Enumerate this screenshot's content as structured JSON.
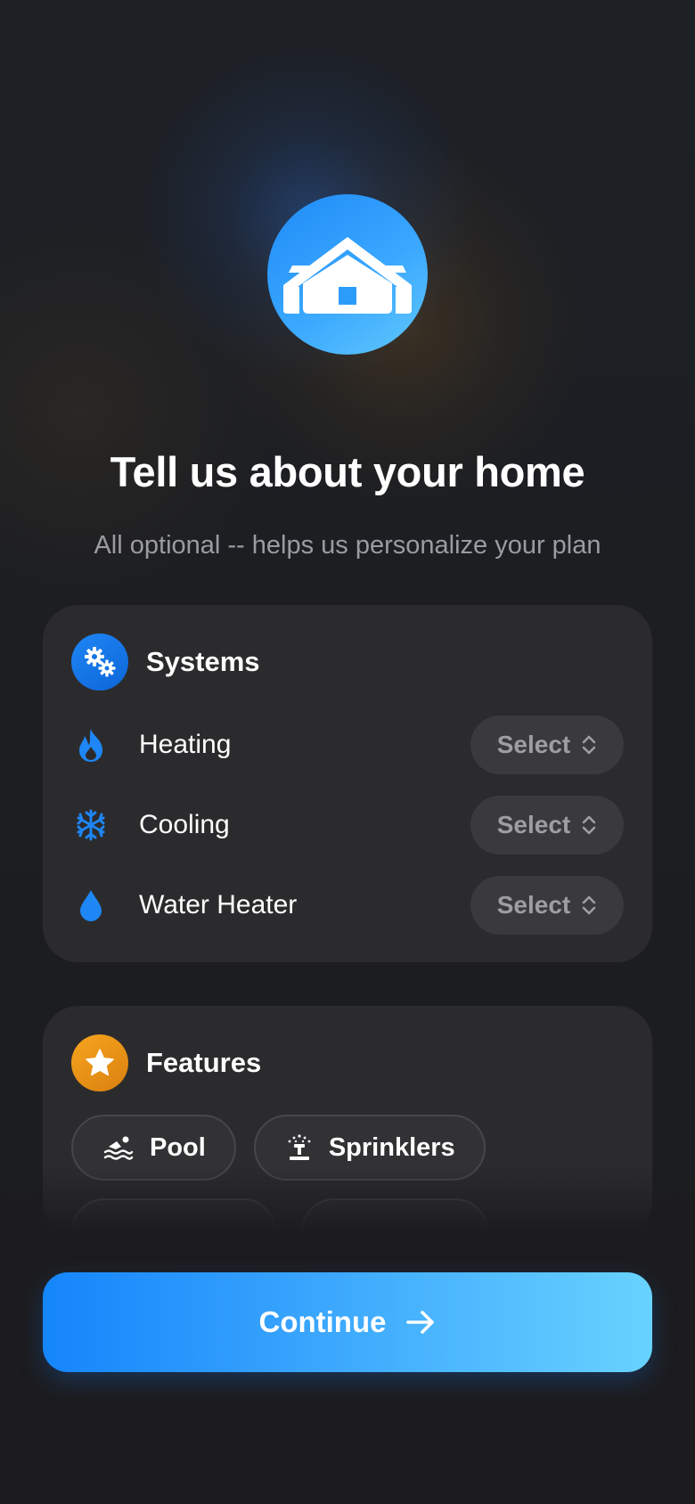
{
  "header": {
    "title": "Tell us about your home",
    "subtitle": "All optional -- helps us personalize your plan",
    "hero_icon": "house-icon"
  },
  "systems": {
    "title": "Systems",
    "icon": "gears-icon",
    "items": [
      {
        "label": "Heating",
        "icon": "flame-icon",
        "select_label": "Select"
      },
      {
        "label": "Cooling",
        "icon": "snowflake-icon",
        "select_label": "Select"
      },
      {
        "label": "Water Heater",
        "icon": "water-drop-icon",
        "select_label": "Select"
      }
    ]
  },
  "features": {
    "title": "Features",
    "icon": "star-icon",
    "chips": [
      {
        "label": "Pool",
        "icon": "swimmer-icon"
      },
      {
        "label": "Sprinklers",
        "icon": "sprinkler-icon"
      }
    ]
  },
  "footer": {
    "continue_label": "Continue",
    "continue_icon": "arrow-right-icon"
  },
  "colors": {
    "accent": "#1E86F5",
    "accent_light": "#68D2FE",
    "features_badge": "#F0951A",
    "card": "#2B2B2D",
    "background": "#1C1D20"
  }
}
